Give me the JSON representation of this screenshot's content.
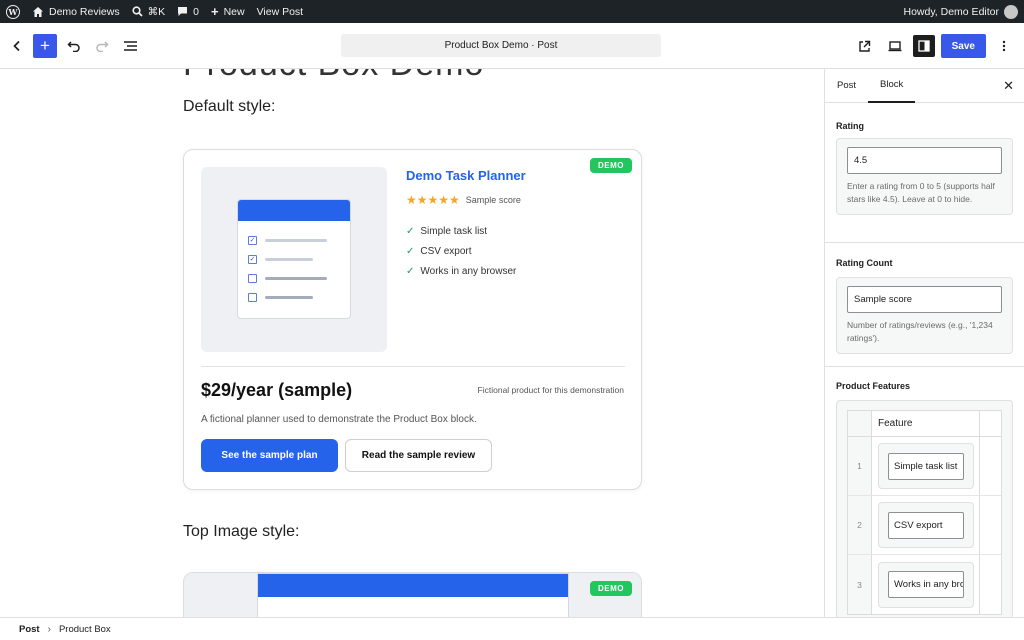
{
  "adminbar": {
    "site_name": "Demo Reviews",
    "shortcut": "⌘K",
    "comments": "0",
    "new_label": "New",
    "view_post": "View Post",
    "howdy": "Howdy, Demo Editor"
  },
  "header": {
    "doc_title": "Product Box Demo · Post",
    "save_label": "Save"
  },
  "canvas": {
    "page_heading": "Product Box Demo",
    "section1_heading": "Default style:",
    "section2_heading": "Top Image style:",
    "product": {
      "badge": "DEMO",
      "title": "Demo Task Planner",
      "stars": "★★★★★",
      "rating_count": "Sample score",
      "features": [
        "Simple task list",
        "CSV export",
        "Works in any browser"
      ],
      "price": "$29/year (sample)",
      "fineprint": "Fictional product for this demonstration",
      "description": "A fictional planner used to demonstrate the Product Box block.",
      "primary_button": "See the sample plan",
      "secondary_button": "Read the sample review"
    },
    "product2_badge": "DEMO"
  },
  "sidebar": {
    "tab_post": "Post",
    "tab_block": "Block",
    "rating": {
      "label": "Rating",
      "value": "4.5",
      "help": "Enter a rating from 0 to 5 (supports half stars like 4.5). Leave at 0 to hide."
    },
    "rating_count": {
      "label": "Rating Count",
      "value": "Sample score",
      "help": "Number of ratings/reviews (e.g., '1,234 ratings')."
    },
    "features": {
      "label": "Product Features",
      "column_header": "Feature",
      "rows": [
        {
          "num": "1",
          "value": "Simple task list"
        },
        {
          "num": "2",
          "value": "CSV export"
        },
        {
          "num": "3",
          "value": "Works in any browser"
        }
      ]
    }
  },
  "footer": {
    "crumb1": "Post",
    "crumb2": "Product Box"
  },
  "colors": {
    "accent": "#3858e9",
    "product_blue": "#2563eb",
    "badge_green": "#22c55e",
    "star": "#f5a623"
  }
}
